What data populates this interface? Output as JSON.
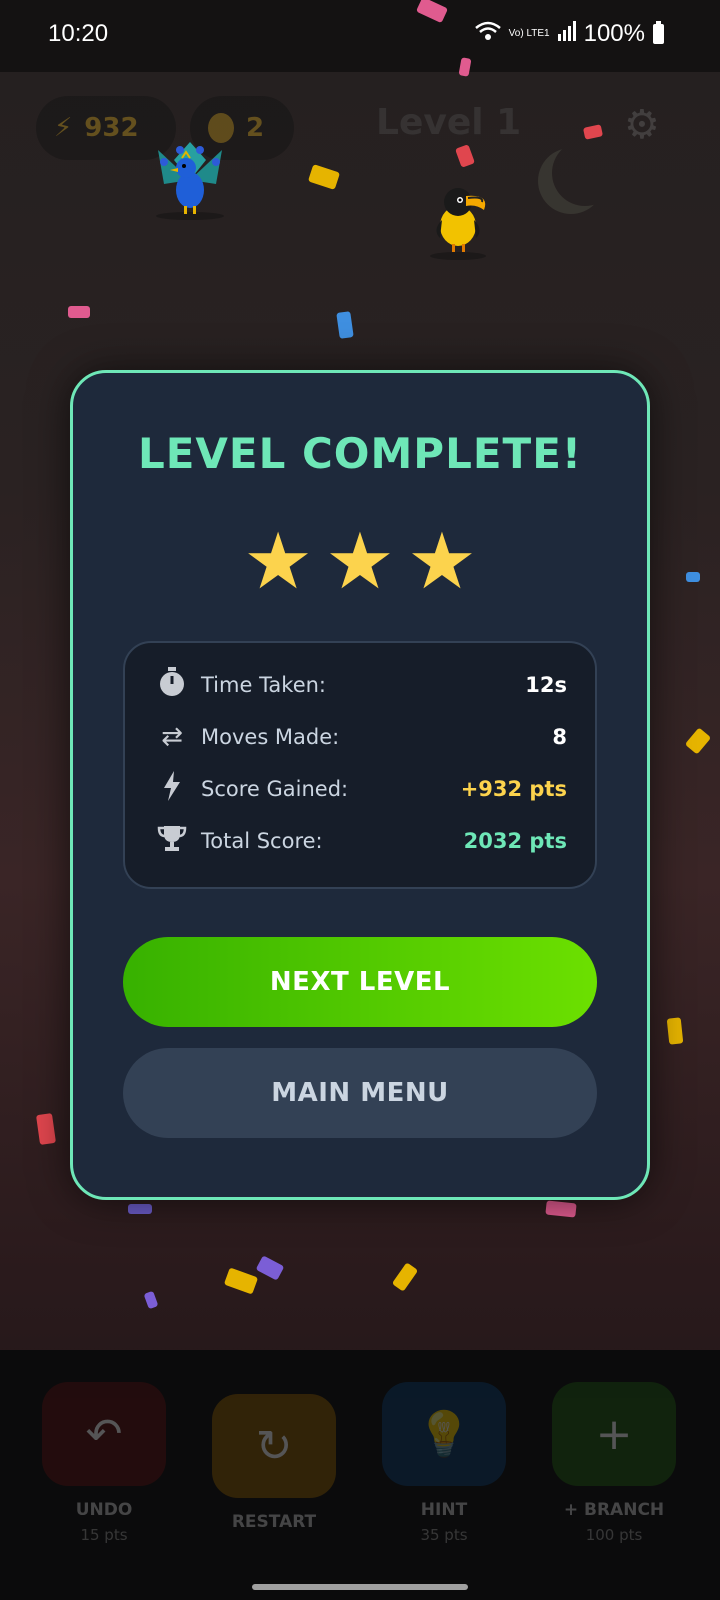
{
  "status": {
    "time": "10:20",
    "network": "Vo) LTE1",
    "battery": "100%",
    "icons": [
      "wifi-icon",
      "signal-icon",
      "battery-icon"
    ]
  },
  "hud": {
    "energy": "932",
    "coins": "2",
    "level": "Level 1",
    "icons": [
      "lightning-icon",
      "coin-icon",
      "gear-icon",
      "moon-icon"
    ]
  },
  "modal": {
    "title": "LEVEL COMPLETE!",
    "stars_earned": 3,
    "stats": [
      {
        "icon": "stopwatch-icon",
        "label": "Time Taken:",
        "value": "12s"
      },
      {
        "icon": "swap-arrows-icon",
        "label": "Moves Made:",
        "value": "8"
      },
      {
        "icon": "lightning-icon",
        "label": "Score Gained:",
        "value": "+932 pts"
      },
      {
        "icon": "trophy-icon",
        "label": "Total Score:",
        "value": "2032 pts"
      }
    ],
    "next_button": "NEXT LEVEL",
    "menu_button": "MAIN MENU"
  },
  "toolbar": [
    {
      "label": "UNDO",
      "cost": "15 pts",
      "icon": "undo-icon"
    },
    {
      "label": "RESTART",
      "cost": "",
      "icon": "restart-icon"
    },
    {
      "label": "HINT",
      "cost": "35 pts",
      "icon": "lightbulb-icon"
    },
    {
      "label": "+ BRANCH",
      "cost": "100 pts",
      "icon": "plus-icon"
    }
  ],
  "colors": {
    "accent_green": "#6ee7b7",
    "star_yellow": "#fcd34d",
    "modal_bg": "#1e293b",
    "next_button": "#4cc000",
    "menu_button": "#334155"
  }
}
